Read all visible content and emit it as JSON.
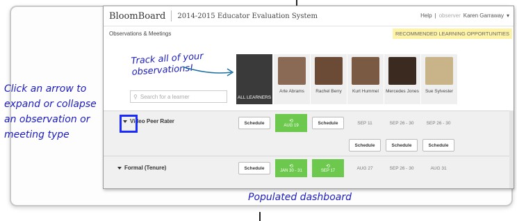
{
  "annotations": {
    "left_note": "Click an arrow to expand or collapse an observation or meeting type",
    "bottom_note": "Populated dashboard",
    "track_note": "Track all of your observations!"
  },
  "app": {
    "logo": "BloomBoard",
    "title": "2014-2015 Educator Evaluation System",
    "help": "Help",
    "observer_label": "observer",
    "user": "Karen Garraway",
    "subnav": "Observations & Meetings",
    "recommended": "RECOMMENDED LEARNING OPPORTUNITIES",
    "search_placeholder": "Search for a learner",
    "all_learners": "ALL LEARNERS"
  },
  "learners": [
    {
      "name": "Arte Abrams",
      "color": "#8a6a55"
    },
    {
      "name": "Rachel Berry",
      "color": "#6b4a36"
    },
    {
      "name": "Kurt Hummel",
      "color": "#7b5a44"
    },
    {
      "name": "Mercedes Jones",
      "color": "#3a2a20"
    },
    {
      "name": "Sue Sylvester",
      "color": "#c9b48a"
    }
  ],
  "sections": [
    {
      "label": "Video Peer Rater",
      "schedule": "Schedule",
      "cells": [
        "AUG 19",
        "Schedule",
        "SEP 11",
        "SEP 26 - 30",
        "SEP 26 - 30"
      ],
      "row2": [
        "Schedule",
        "Schedule",
        "Schedule"
      ]
    },
    {
      "label": "Formal (Tenure)",
      "schedule": "Schedule",
      "cells": [
        "JAN 30 - 31",
        "SEP 17",
        "AUG 27",
        "SEP 26 - 30",
        "AUG 31"
      ]
    }
  ],
  "colors": {
    "accent_green": "#6cc94e",
    "callout_blue": "#1a2bff",
    "highlight_yellow": "#fff3a8"
  }
}
